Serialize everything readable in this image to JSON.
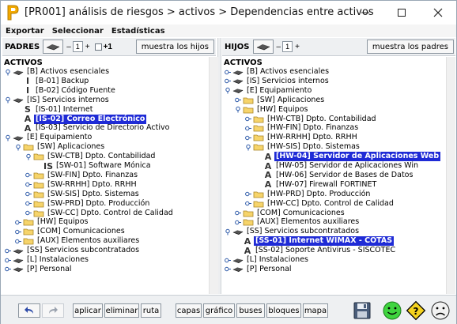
{
  "window": {
    "title": "[PR001] análisis de riesgos > activos > Dependencias entre activos"
  },
  "menu": [
    "Exportar",
    "Seleccionar",
    "Estadísticas"
  ],
  "left": {
    "toolbar": {
      "label": "PADRES",
      "depth_value": "1",
      "depth_minus": "–",
      "depth_plus": "+",
      "plus1_label": "+1",
      "show_button": "muestra los hijos"
    },
    "root": "ACTIVOS",
    "nodes": [
      {
        "label": "[B] Activos esenciales",
        "icon": "layer"
      },
      {
        "label": "[B-01] Backup",
        "icon": "I"
      },
      {
        "label": "[B-02] Código Fuente",
        "icon": "I"
      },
      {
        "label": "[IS] Servicios internos",
        "icon": "layer"
      },
      {
        "label": "[IS-01] Internet",
        "icon": "S"
      },
      {
        "label": "[IS-02] Correo Electrónico",
        "icon": "A"
      },
      {
        "label": "[IS-03] Servicio de Directorio Activo",
        "icon": "A"
      },
      {
        "label": "[E] Equipamiento",
        "icon": "layer"
      },
      {
        "label": "[SW] Aplicaciones",
        "icon": "folder"
      },
      {
        "label": "[SW-CTB] Dpto. Contabilidad",
        "icon": "folder"
      },
      {
        "label": "[SW-01] Software Mónica",
        "icon": "IS"
      },
      {
        "label": "[SW-FIN] Dpto. Finanzas",
        "icon": "folder"
      },
      {
        "label": "[SW-RRHH] Dpto. RRHH",
        "icon": "folder"
      },
      {
        "label": "[SW-SIS] Dpto. Sistemas",
        "icon": "folder"
      },
      {
        "label": "[SW-PRD] Dpto. Producción",
        "icon": "folder"
      },
      {
        "label": "[SW-CC] Dpto. Control de Calidad",
        "icon": "folder"
      },
      {
        "label": "[HW] Equipos",
        "icon": "folder"
      },
      {
        "label": "[COM] Comunicaciones",
        "icon": "folder"
      },
      {
        "label": "[AUX] Elementos auxiliares",
        "icon": "folder"
      },
      {
        "label": "[SS] Servicios subcontratados",
        "icon": "layer"
      },
      {
        "label": "[L] Instalaciones",
        "icon": "layer"
      },
      {
        "label": "[P] Personal",
        "icon": "layer"
      }
    ]
  },
  "right": {
    "toolbar": {
      "label": "HIJOS",
      "depth_value": "1",
      "depth_minus": "–",
      "depth_plus": "+",
      "show_button": "muestra los padres"
    },
    "root": "ACTIVOS",
    "nodes": [
      {
        "label": "[B] Activos esenciales",
        "icon": "layer"
      },
      {
        "label": "[IS] Servicios internos",
        "icon": "layer"
      },
      {
        "label": "[E] Equipamiento",
        "icon": "layer"
      },
      {
        "label": "[SW] Aplicaciones",
        "icon": "folder"
      },
      {
        "label": "[HW] Equipos",
        "icon": "folder"
      },
      {
        "label": "[HW-CTB] Dpto. Contabilidad",
        "icon": "folder"
      },
      {
        "label": "[HW-FIN] Dpto. Finanzas",
        "icon": "folder"
      },
      {
        "label": "[HW-RRHH] Dpto. RRHH",
        "icon": "folder"
      },
      {
        "label": "[HW-SIS] Dpto. Sistemas",
        "icon": "folder"
      },
      {
        "label": "[HW-04] Servidor de Aplicaciones Web",
        "icon": "A"
      },
      {
        "label": "[HW-05] Servidor de Aplicaciones Win",
        "icon": "A"
      },
      {
        "label": "[HW-06] Servidor de Bases de Datos",
        "icon": "A"
      },
      {
        "label": "[HW-07] Firewall FORTINET",
        "icon": "A"
      },
      {
        "label": "[HW-PRD] Dpto. Producción",
        "icon": "folder"
      },
      {
        "label": "[HW-CC] Dpto. Control de Calidad",
        "icon": "folder"
      },
      {
        "label": "[COM] Comunicaciones",
        "icon": "folder"
      },
      {
        "label": "[AUX] Elementos auxiliares",
        "icon": "folder"
      },
      {
        "label": "[SS] Servicios subcontratados",
        "icon": "layer"
      },
      {
        "label": "[SS-01] Internet WIMAX - COTAS",
        "icon": "A"
      },
      {
        "label": "[SS-02] Soporte Antivirus - SISCOTEC",
        "icon": "A"
      },
      {
        "label": "[L] Instalaciones",
        "icon": "layer"
      },
      {
        "label": "[P] Personal",
        "icon": "layer"
      }
    ]
  },
  "bottom": {
    "buttons": [
      "aplicar",
      "eliminar",
      "ruta",
      "capas",
      "gráfico",
      "buses",
      "bloques",
      "mapa"
    ]
  }
}
